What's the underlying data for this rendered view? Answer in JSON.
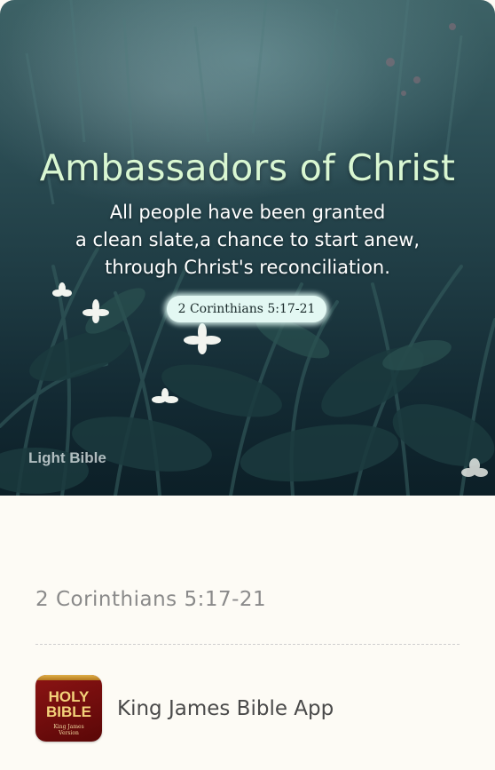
{
  "hero": {
    "title": "Ambassadors of Christ",
    "verse_lines": [
      "All people have been granted",
      "a clean slate,a chance to start anew,",
      "through Christ's reconciliation."
    ],
    "reference_pill": "2 Corinthians 5:17-21",
    "watermark": "Light Bible"
  },
  "reference": "2 Corinthians 5:17-21",
  "app": {
    "icon_line1": "HOLY",
    "icon_line2": "BIBLE",
    "icon_sub1": "King James",
    "icon_sub2": "Version",
    "name": "King James Bible App"
  },
  "colors": {
    "title": "#d9f7d2",
    "pill": "#e3f8f3",
    "icon_red": "#8c1414",
    "icon_gold": "#f4d27a"
  }
}
